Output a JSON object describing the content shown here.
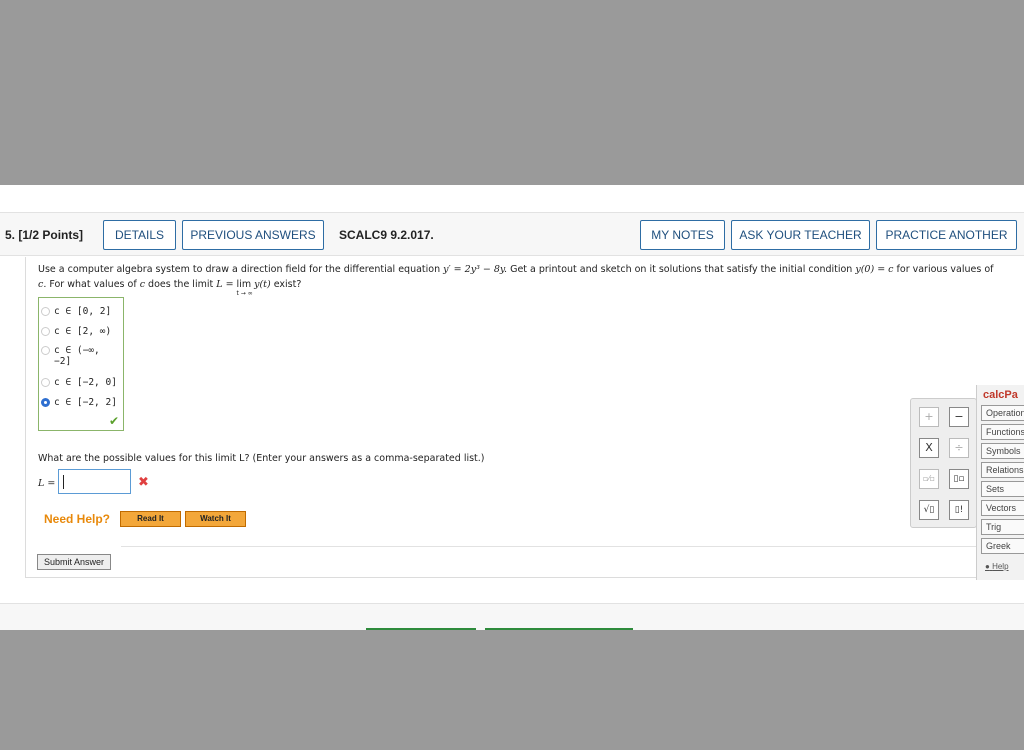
{
  "question": {
    "number": "5.",
    "points": "[1/2 Points]",
    "code": "SCALC9 9.2.017.",
    "header_buttons": {
      "details": "DETAILS",
      "previous_answers": "PREVIOUS ANSWERS",
      "my_notes": "MY NOTES",
      "ask_teacher": "ASK YOUR TEACHER",
      "practice_another": "PRACTICE ANOTHER"
    },
    "text": {
      "p1": "Use a computer algebra system to draw a direction field for the differential equation ",
      "eq": "y′ = 2y³ − 8y.",
      "p2": " Get a printout and sketch on it solutions that satisfy the initial condition ",
      "ic": "y(0) = c",
      "p3": " for various values of ",
      "c": "c.",
      "p4": " For what values of ",
      "c2": "c",
      "p5": " does the limit ",
      "lim_lhs": "L = ",
      "lim": "lim",
      "lim_sub": "t → ∞",
      "lim_arg": " y(t)",
      "p6": " exist?"
    },
    "choices": [
      {
        "label": "c ∈ [0, 2]",
        "selected": false
      },
      {
        "label": "c ∈ [2, ∞)",
        "selected": false
      },
      {
        "label": "c ∈ (−∞,",
        "label2": "−2]",
        "selected": false
      },
      {
        "label": "c ∈ [−2, 0]",
        "selected": false
      },
      {
        "label": "c ∈ [−2, 2]",
        "selected": true
      }
    ],
    "choice_correct_mark": "✔",
    "part2_text": "What are the possible values for this limit L? (Enter your answers as a comma-separated list.)",
    "answer_label": "L =",
    "answer_value": "",
    "wrong_mark": "✖",
    "need_help": "Need Help?",
    "read_it": "Read It",
    "watch_it": "Watch It",
    "submit": "Submit Answer"
  },
  "calc_keys": [
    "+",
    "−",
    "X",
    "÷",
    "▫⁄▫",
    "▯▫",
    "√▯",
    "▯!"
  ],
  "calcpad": {
    "title": "calcPa",
    "tabs": [
      "Operation",
      "Functions",
      "Symbols",
      "Relations",
      "Sets",
      "Vectors",
      "Trig",
      "Greek"
    ],
    "help": "Help"
  },
  "colors": {
    "header_button_border": "#2e6da4",
    "help_orange": "#e8890b",
    "correct_green": "#5aa02c",
    "wrong_red": "#e04040",
    "overlay_gray": "#9a9a9a"
  }
}
